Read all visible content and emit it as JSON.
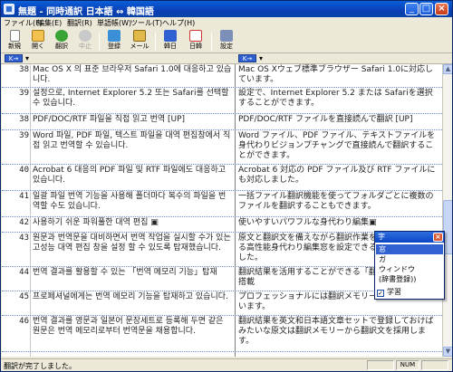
{
  "window": {
    "title": "無題 - 同時通訳 日本語 ⇔ 韓国語"
  },
  "menu": [
    {
      "label": "ファイル(F)"
    },
    {
      "label": "編集(E)"
    },
    {
      "label": "翻訳(R)"
    },
    {
      "label": "単語帳(W)"
    },
    {
      "label": "ツール(T)"
    },
    {
      "label": "ヘルプ(H)"
    }
  ],
  "toolbar": [
    {
      "label": "新規",
      "icon": "new-document-icon",
      "color": "#ffffff",
      "enabled": true
    },
    {
      "label": "開く",
      "icon": "folder-open-icon",
      "color": "#f2c14e",
      "enabled": true
    },
    {
      "label": "翻訳",
      "icon": "translate-icon",
      "color": "#3aa335",
      "enabled": true
    },
    {
      "label": "中止",
      "icon": "stop-icon",
      "color": "#c9c9c9",
      "enabled": false
    },
    {
      "label": "登録",
      "icon": "register-icon",
      "color": "#3a8fd6",
      "enabled": true
    },
    {
      "label": "メール",
      "icon": "mail-icon",
      "color": "#e0b94a",
      "enabled": true
    },
    {
      "label": "韓日",
      "icon": "korean-japanese-icon",
      "color": "#2f5fd0",
      "enabled": true
    },
    {
      "label": "日韓",
      "icon": "japanese-korean-icon",
      "color": "#d0382f",
      "enabled": true
    },
    {
      "label": "設定",
      "icon": "settings-icon",
      "color": "#7b8fb8",
      "enabled": true
    }
  ],
  "lang_header": {
    "left": "K→",
    "right": "K→"
  },
  "rows": [
    {
      "num": "38",
      "ko": "Mac OS X 의 표준 브라우저 Safari 1.0에 대응하고 있습니다.",
      "ja": "Mac OS Xウェブ標準ブラウザー Safari 1.0に対応しています。"
    },
    {
      "num": "39",
      "ko": "설정으로, Internet Explorer 5.2 또는 Safari를 선택할 수 있습니다.",
      "ja": "設定で、Internet Explorer 5.2 または Safariを選択することができます。"
    },
    {
      "num": "38",
      "ko": "PDF/DOC/RTF 파일을 직접 읽고 번역 [UP]",
      "ja": "PDF/DOC/RTF ファイルを直接読んで翻訳 [UP]"
    },
    {
      "num": "39",
      "ko": "Word 파일, PDF 파일, 텍스트 파일을 대역 편집창에서 직접 읽고 번역할 수 있습니다.",
      "ja": "Word ファイル、PDF ファイル、テキストファイルを身代わりビジョンプチャングで直接読んで翻訳することができます。"
    },
    {
      "num": "40",
      "ko": "Acrobat 6 대응의 PDF 파일 및 RTF 파일에도 대응하고 있습니다.",
      "ja": "Acrobat 6 対応の PDF ファイル及び RTF ファイルにも対応しました。"
    },
    {
      "num": "41",
      "ko": "일괄 파일 번역 기능을 사용해 폴더마다 복수의 파일을 번역할 수도 있습니다.",
      "ja": "一括ファイル翻訳機能を使ってフォルダごとに複数のファイルを翻訳することもできます。"
    },
    {
      "num": "42",
      "ko": "사용하기 쉬운 파워풀한 대역 편집 ▣",
      "ja": "使いやすいパワフルな身代わり編集▣"
    },
    {
      "num": "43",
      "ko": "원문과 번역문을 대비하면서 번역 작업을 실시할 수가 있는 고성능 대역 편집 창을 설정 할 수 있도록 탑재했습니다.",
      "ja": "原文と翻訳文を備えながら翻訳作業をすることができる高性能身代わり編集窓を設定できるように搭載しました。"
    },
    {
      "num": "44",
      "ko": "번역 결과를 활용할 수 있는 「번역 메모리 기능」탑재",
      "ja": "翻訳結果を活用することができる「翻訳メモリー機能」搭載"
    },
    {
      "num": "45",
      "ko": "프로페셔널에게는 번역 메모리 기능을 탑재하고 있습니다.",
      "ja": "プロフェッショナルには翻訳メモリー機能を搭載しています。"
    },
    {
      "num": "46",
      "ko": "번역 결과를 영문과 일본어 문장세트로 등록해 두면 같은 원문은 번역 메모리로부터 번역문을 채용합니다.",
      "ja": "翻訳結果を英文和日本語文章セットで登録しておけばみたいな原文は翻訳メモリーから翻訳文を採用します。"
    }
  ],
  "popup": {
    "title": "字",
    "items": [
      {
        "label": "窓",
        "selected": true
      },
      {
        "label": "ガ",
        "selected": false
      },
      {
        "label": "ウィンドウ",
        "selected": false
      },
      {
        "label": "(辞書登録))",
        "selected": false
      }
    ],
    "checkbox_label": "学習",
    "checkbox_checked": true
  },
  "status": {
    "text": "翻訳が完了しました。",
    "panels": [
      "",
      "NUM",
      ""
    ]
  }
}
